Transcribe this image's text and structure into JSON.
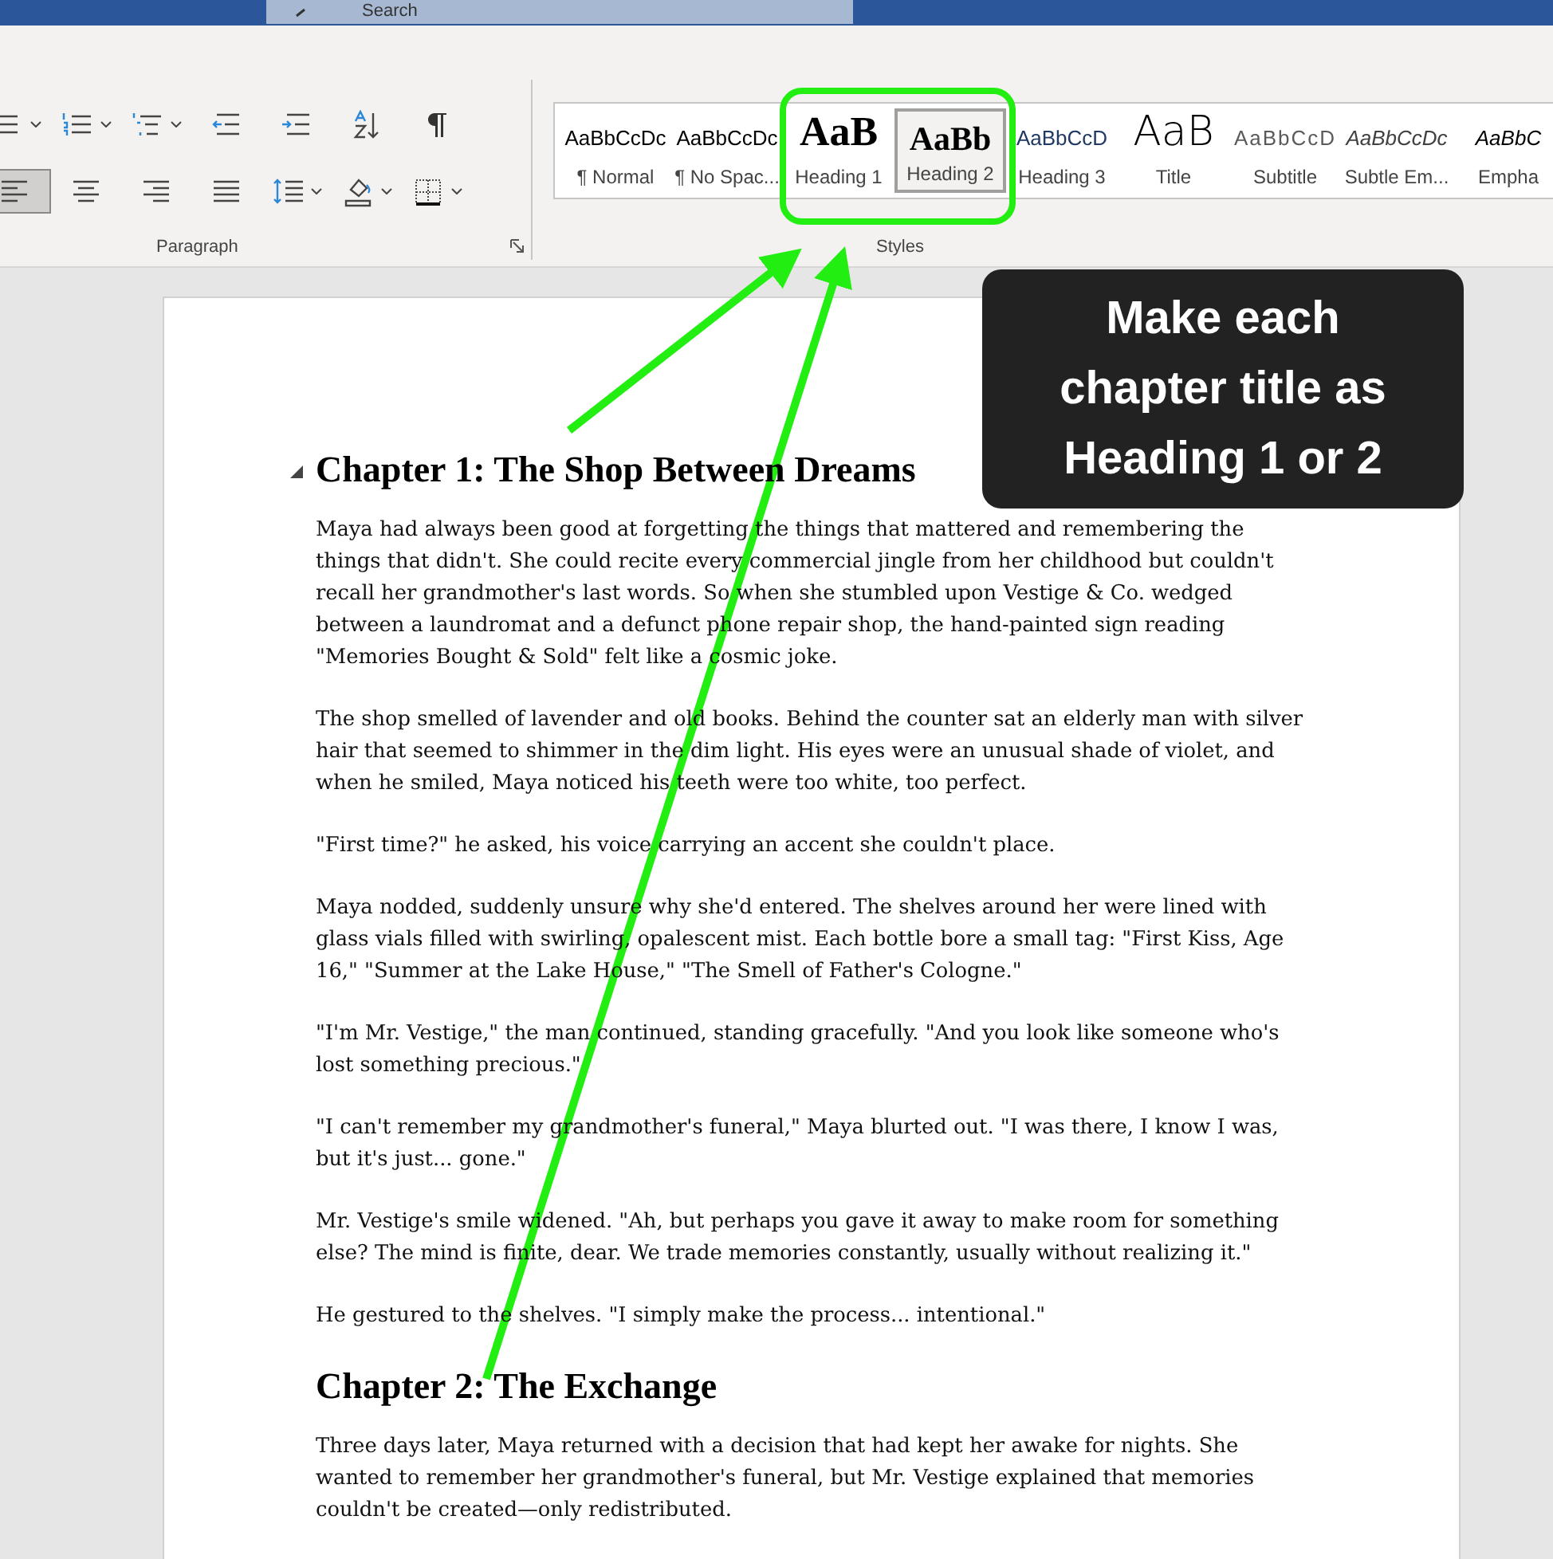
{
  "title_bar": {
    "search": {
      "placeholder": "Search"
    }
  },
  "ribbon": {
    "paragraph_group": {
      "label": "Paragraph",
      "rows": [
        [
          {
            "kind": "bullets",
            "dropdown": true,
            "selected": false
          },
          {
            "kind": "numbering",
            "dropdown": true,
            "selected": false
          },
          {
            "kind": "multilevel",
            "dropdown": true,
            "selected": false
          },
          {
            "kind": "outdent",
            "dropdown": false,
            "selected": false
          },
          {
            "kind": "indent",
            "dropdown": false,
            "selected": false
          },
          {
            "kind": "sort",
            "dropdown": false,
            "selected": false
          },
          {
            "kind": "pilcrow",
            "dropdown": false,
            "selected": false
          }
        ],
        [
          {
            "kind": "align-left",
            "dropdown": false,
            "selected": true
          },
          {
            "kind": "align-center",
            "dropdown": false,
            "selected": false
          },
          {
            "kind": "align-right",
            "dropdown": false,
            "selected": false
          },
          {
            "kind": "justify",
            "dropdown": false,
            "selected": false
          },
          {
            "kind": "line-spacing",
            "dropdown": true,
            "selected": false
          },
          {
            "kind": "shading",
            "dropdown": true,
            "selected": false
          },
          {
            "kind": "borders",
            "dropdown": true,
            "selected": false
          }
        ]
      ]
    },
    "styles_group": {
      "label": "Styles",
      "styles": [
        {
          "kind": "normal",
          "preview": "AaBbCcDc",
          "label": "¶ Normal",
          "selected": false
        },
        {
          "kind": "nospacing",
          "preview": "AaBbCcDc",
          "label": "¶ No Spac...",
          "selected": false
        },
        {
          "kind": "heading1",
          "preview": "AaB",
          "label": "Heading 1",
          "selected": false
        },
        {
          "kind": "heading2",
          "preview": "AaBb",
          "label": "Heading 2",
          "selected": true
        },
        {
          "kind": "heading3",
          "preview": "AaBbCcD",
          "label": "Heading 3",
          "selected": false
        },
        {
          "kind": "title",
          "preview": "AaB",
          "label": "Title",
          "selected": false
        },
        {
          "kind": "subtitle",
          "preview": "AaBbCcD",
          "label": "Subtitle",
          "selected": false
        },
        {
          "kind": "subtle",
          "preview": "AaBbCcDc",
          "label": "Subtle Em...",
          "selected": false
        },
        {
          "kind": "emphasis",
          "preview": "AaBbC",
          "label": "Empha",
          "selected": false
        }
      ]
    }
  },
  "document": {
    "chapters": [
      {
        "heading": "Chapter 1: The Shop Between Dreams",
        "collapse_marker": true,
        "paragraphs": [
          "Maya had always been good at forgetting the things that mattered and remembering the things that didn't. She could recite every commercial jingle from her childhood but couldn't recall her grandmother's last words. So when she stumbled upon Vestige & Co. wedged between a laundromat and a defunct phone repair shop, the hand-painted sign reading \"Memories Bought & Sold\" felt like a cosmic joke.",
          "The shop smelled of lavender and old books. Behind the counter sat an elderly man with silver hair that seemed to shimmer in the dim light. His eyes were an unusual shade of violet, and when he smiled, Maya noticed his teeth were too white, too perfect.",
          "\"First time?\" he asked, his voice carrying an accent she couldn't place.",
          "Maya nodded, suddenly unsure why she'd entered. The shelves around her were lined with glass vials filled with swirling, opalescent mist. Each bottle bore a small tag: \"First Kiss, Age 16,\" \"Summer at the Lake House,\" \"The Smell of Father's Cologne.\"",
          "\"I'm Mr. Vestige,\" the man continued, standing gracefully. \"And you look like someone who's lost something precious.\"",
          "\"I can't remember my grandmother's funeral,\" Maya blurted out. \"I was there, I know I was, but it's just... gone.\"",
          "Mr. Vestige's smile widened. \"Ah, but perhaps you gave it away to make room for something else? The mind is finite, dear. We trade memories constantly, usually without realizing it.\"",
          "He gestured to the shelves. \"I simply make the process... intentional.\""
        ]
      },
      {
        "heading": "Chapter 2: The Exchange",
        "collapse_marker": false,
        "paragraphs": [
          "Three days later, Maya returned with a decision that had kept her awake for nights. She wanted to remember her grandmother's funeral, but Mr. Vestige explained that memories couldn't be created—only redistributed."
        ]
      }
    ]
  },
  "annotation": {
    "callout": "Make each chapter title as Heading 1 or 2"
  }
}
